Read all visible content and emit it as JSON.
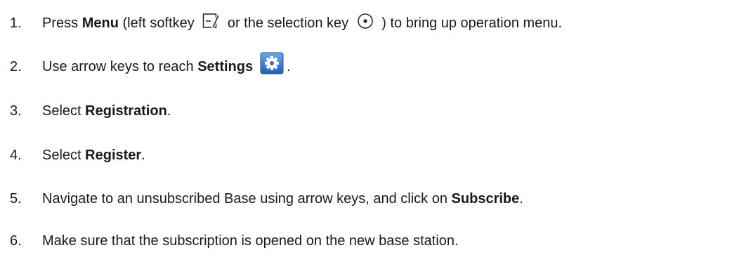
{
  "steps": [
    {
      "number": "1.",
      "parts": [
        "Press ",
        "Menu",
        " (left softkey ",
        " or the selection key ",
        " ) to bring up operation menu."
      ]
    },
    {
      "number": "2.",
      "parts": [
        "Use arrow keys to reach ",
        "Settings",
        "."
      ]
    },
    {
      "number": "3.",
      "parts": [
        "Select ",
        "Registration",
        "."
      ]
    },
    {
      "number": "4.",
      "parts": [
        "Select ",
        "Register",
        "."
      ]
    },
    {
      "number": "5.",
      "parts": [
        "Navigate to an unsubscribed Base using arrow keys, and click on ",
        "Subscribe",
        "."
      ]
    },
    {
      "number": "6.",
      "parts": [
        "Make sure that the subscription is opened on the new base station."
      ]
    }
  ],
  "icons": {
    "softkey": "left-softkey-icon",
    "select": "selection-key-icon",
    "settings": "settings-gear-icon"
  },
  "colors": {
    "settings_icon_bg": "#2f6fc4",
    "text": "#1a1a1a"
  }
}
